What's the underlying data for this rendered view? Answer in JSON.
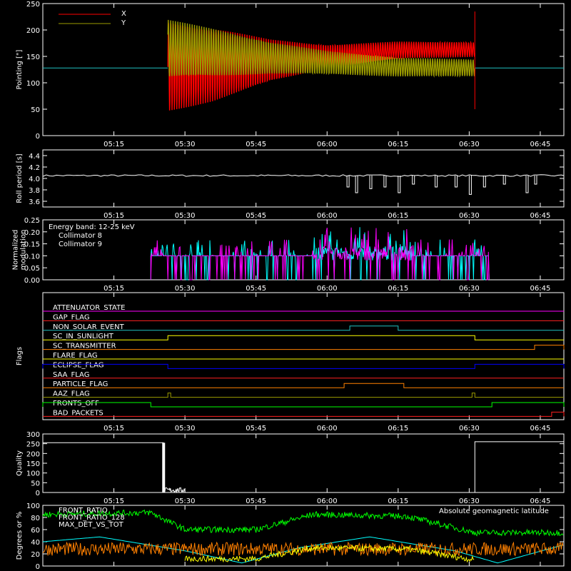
{
  "colors": {
    "background": "#000000",
    "frame": "#ffffff",
    "red": "#ff0000",
    "olive": "#9b9b00",
    "cyan": "#00ffff",
    "magenta": "#ff00ff",
    "green": "#00ff00",
    "yellow": "#ffff00",
    "orange": "#ff8000",
    "blue": "#0000ff",
    "teal": "#20c0c0",
    "purple": "#c000c0"
  },
  "time_axis": {
    "range_hours": [
      5.0,
      6.833
    ],
    "tick_labels": [
      "05:15",
      "05:30",
      "05:45",
      "06:00",
      "06:15",
      "06:30",
      "06:45"
    ],
    "tick_hours": [
      5.25,
      5.5,
      5.75,
      6.0,
      6.25,
      6.5,
      6.75
    ]
  },
  "chart_data": [
    {
      "id": "pointing",
      "type": "line",
      "ylabel": "Pointing [\"]",
      "ylim": [
        0,
        250
      ],
      "yticks": [
        0,
        50,
        100,
        150,
        200,
        250
      ],
      "legend": [
        {
          "name": "X",
          "color": "#ff0000"
        },
        {
          "name": "Y",
          "color": "#9b9b00"
        }
      ],
      "baseline": 128,
      "active_interval": [
        5.44,
        6.52
      ],
      "series": [
        {
          "name": "X",
          "color": "#ff0000",
          "center": [
            [
              5.44,
              130
            ],
            [
              5.75,
              140
            ],
            [
              6.0,
              150
            ],
            [
              6.25,
              162
            ],
            [
              6.52,
              163
            ]
          ],
          "amplitude": [
            [
              5.44,
              85
            ],
            [
              5.6,
              70
            ],
            [
              5.8,
              40
            ],
            [
              6.0,
              22
            ],
            [
              6.25,
              16
            ],
            [
              6.52,
              14
            ]
          ]
        },
        {
          "name": "Y",
          "color": "#9b9b00",
          "center": [
            [
              5.44,
              165
            ],
            [
              5.75,
              150
            ],
            [
              6.0,
              138
            ],
            [
              6.25,
              130
            ],
            [
              6.52,
              128
            ]
          ],
          "amplitude": [
            [
              5.44,
              55
            ],
            [
              5.6,
              45
            ],
            [
              5.8,
              30
            ],
            [
              6.0,
              22
            ],
            [
              6.25,
              18
            ],
            [
              6.52,
              16
            ]
          ]
        }
      ]
    },
    {
      "id": "roll-period",
      "type": "line",
      "ylabel": "Roll period [s]",
      "ylim": [
        3.5,
        4.5
      ],
      "yticks": [
        3.6,
        3.8,
        4.0,
        4.2,
        4.4
      ],
      "base": 4.05,
      "dips": [
        [
          6.07,
          3.85
        ],
        [
          6.1,
          3.75
        ],
        [
          6.15,
          3.82
        ],
        [
          6.2,
          3.85
        ],
        [
          6.25,
          3.75
        ],
        [
          6.3,
          3.9
        ],
        [
          6.38,
          3.85
        ],
        [
          6.45,
          3.85
        ],
        [
          6.5,
          3.72
        ],
        [
          6.55,
          3.85
        ],
        [
          6.62,
          3.9
        ],
        [
          6.7,
          3.75
        ],
        [
          6.73,
          3.9
        ]
      ]
    },
    {
      "id": "modulation",
      "type": "line",
      "ylabel": "Normalized modulation",
      "ylim": [
        0,
        0.25
      ],
      "yticks": [
        0.0,
        0.05,
        0.1,
        0.15,
        0.2,
        0.25
      ],
      "annotation": "Energy band: 12-25 keV",
      "series": [
        {
          "name": "Collimator 8",
          "color": "#00ffff"
        },
        {
          "name": "Collimator 9",
          "color": "#ff00ff"
        }
      ],
      "interval": [
        5.38,
        6.57
      ],
      "base_level": 0.1
    },
    {
      "id": "flags",
      "type": "line",
      "ylabel": "Flags",
      "rows": [
        {
          "name": "ATTENUATOR_STATE",
          "color": "#ff00ff",
          "steps": [],
          "dashed": false
        },
        {
          "name": "GAP_FLAG",
          "color": "#ff2020",
          "steps": [],
          "dashed": false
        },
        {
          "name": "NON_SOLAR_EVENT",
          "color": "#20c0c0",
          "steps": [
            [
              6.08,
              6.25
            ]
          ],
          "dashed": false
        },
        {
          "name": "SC_IN_SUNLIGHT",
          "color": "#ffff00",
          "steps": [
            [
              5.44,
              6.52
            ]
          ],
          "dashed": false,
          "high_before": false
        },
        {
          "name": "SC_TRANSMITTER",
          "color": "#ff8000",
          "steps": [
            [
              6.73,
              6.833
            ]
          ],
          "dashed": false
        },
        {
          "name": "FLARE_FLAG",
          "color": "#ffff00",
          "steps": [],
          "dashed": false
        },
        {
          "name": "ECLIPSE_FLAG",
          "color": "#0000ff",
          "steps": [
            [
              5.0,
              5.44
            ],
            [
              6.52,
              6.833
            ]
          ],
          "dashed": false
        },
        {
          "name": "SAA_FLAG",
          "color": "#ff2020",
          "steps": [],
          "dashed": false
        },
        {
          "name": "PARTICLE_FLAG",
          "color": "#ff8000",
          "steps": [
            [
              6.06,
              6.27
            ]
          ],
          "dashed": false
        },
        {
          "name": "AAZ_FLAG",
          "color": "#9b9b00",
          "steps": [
            [
              5.44,
              5.45
            ],
            [
              6.51,
              6.52
            ]
          ],
          "dashed": false
        },
        {
          "name": "FRONTS_OFF",
          "color": "#00ff00",
          "steps": [
            [
              5.0,
              5.38
            ],
            [
              6.58,
              6.833
            ]
          ],
          "dashed": false
        },
        {
          "name": "BAD_PACKETS",
          "color": "#ff2020",
          "steps": [
            [
              6.79,
              6.833
            ]
          ],
          "dashed": false
        }
      ]
    },
    {
      "id": "quality",
      "type": "line",
      "ylabel": "Quality",
      "ylim": [
        0,
        300
      ],
      "yticks": [
        0,
        50,
        100,
        150,
        200,
        250,
        300
      ],
      "segments": [
        {
          "from": 5.0,
          "to": 5.425,
          "value": 255
        },
        {
          "from": 5.44,
          "to": 5.5,
          "value": 10
        },
        {
          "from": 6.52,
          "to": 6.833,
          "value": 260
        }
      ]
    },
    {
      "id": "geomagnetic",
      "type": "line",
      "ylabel": "Degrees or %",
      "ylim": [
        0,
        100
      ],
      "yticks": [
        0,
        20,
        40,
        60,
        80,
        100
      ],
      "legend": [
        {
          "name": "FRONT_RATIO",
          "color": "#ffff00"
        },
        {
          "name": "FRONT_RATIO_128",
          "color": "#00ff00"
        },
        {
          "name": "MAX_DET_VS_TOT",
          "color": "#ff8000"
        }
      ],
      "annotation": {
        "text": "Absolute geomagnetic latitude",
        "color": "#00ffff"
      },
      "series": [
        {
          "name": "FRONT_RATIO_128",
          "color": "#00ff00",
          "levels": [
            [
              5.0,
              85
            ],
            [
              5.38,
              88
            ],
            [
              5.5,
              60
            ],
            [
              5.75,
              60
            ],
            [
              5.95,
              85
            ],
            [
              6.28,
              82
            ],
            [
              6.52,
              55
            ],
            [
              6.833,
              55
            ]
          ]
        },
        {
          "name": "FRONT_RATIO",
          "color": "#ffff00",
          "levels": [
            [
              5.5,
              12
            ],
            [
              5.75,
              12
            ],
            [
              5.95,
              30
            ],
            [
              6.28,
              28
            ],
            [
              6.52,
              10
            ]
          ]
        },
        {
          "name": "MAX_DET_VS_TOT",
          "color": "#ff8000",
          "levels": [
            [
              5.0,
              28
            ],
            [
              6.833,
              28
            ]
          ]
        },
        {
          "name": "Absolute geomagnetic latitude",
          "color": "#00ffff",
          "levels": [
            [
              5.0,
              40
            ],
            [
              5.2,
              48
            ],
            [
              5.5,
              25
            ],
            [
              5.7,
              5
            ],
            [
              5.9,
              30
            ],
            [
              6.15,
              48
            ],
            [
              6.45,
              25
            ],
            [
              6.6,
              5
            ],
            [
              6.833,
              35
            ]
          ]
        }
      ]
    }
  ]
}
